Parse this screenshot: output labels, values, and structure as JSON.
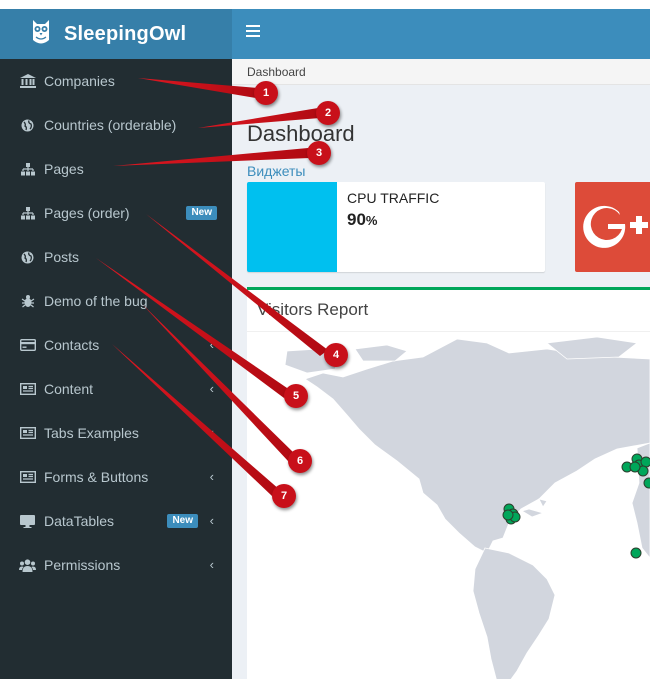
{
  "brand": {
    "logo_icon": "owl-icon",
    "name": "SleepingOwl"
  },
  "header": {
    "toggle_icon": "hamburger-icon"
  },
  "sidebar": {
    "items": [
      {
        "label": "Companies",
        "icon": "bank-icon"
      },
      {
        "label": "Countries (orderable)",
        "icon": "globe-icon"
      },
      {
        "label": "Pages",
        "icon": "sitemap-icon"
      },
      {
        "label": "Pages (order)",
        "icon": "sitemap-icon",
        "badge": "New"
      },
      {
        "label": "Posts",
        "icon": "globe-icon"
      },
      {
        "label": "Demo of the bug",
        "icon": "bug-icon"
      },
      {
        "label": "Contacts",
        "icon": "credit-card-icon",
        "has_submenu": true
      },
      {
        "label": "Content",
        "icon": "newspaper-icon",
        "has_submenu": true
      },
      {
        "label": "Tabs Examples",
        "icon": "newspaper-icon",
        "has_submenu": true
      },
      {
        "label": "Forms & Buttons",
        "icon": "newspaper-icon",
        "has_submenu": true
      },
      {
        "label": "DataTables",
        "icon": "desktop-icon",
        "badge": "New",
        "has_submenu": true
      },
      {
        "label": "Permissions",
        "icon": "users-icon",
        "has_submenu": true
      }
    ]
  },
  "breadcrumb": "Dashboard",
  "page": {
    "title": "Dashboard",
    "widgets_link": "Виджеты"
  },
  "info_box": {
    "label": "CPU TRAFFIC",
    "value": "90",
    "unit": "%"
  },
  "social_box": {
    "icon": "google-plus-icon"
  },
  "report": {
    "title": "Visitors Report"
  },
  "annotations": [
    "1",
    "2",
    "3",
    "4",
    "5",
    "6",
    "7"
  ],
  "colors": {
    "sidebar": "#222d32",
    "logo_bar": "#367fa9",
    "navbar": "#3c8dbc",
    "info_aqua": "#00c0ef",
    "google_red": "#dd4b39",
    "box_border": "#00a65a",
    "annotation_red": "#c8101a",
    "map_land": "#d2d6de",
    "map_marker": "#00a65a"
  }
}
